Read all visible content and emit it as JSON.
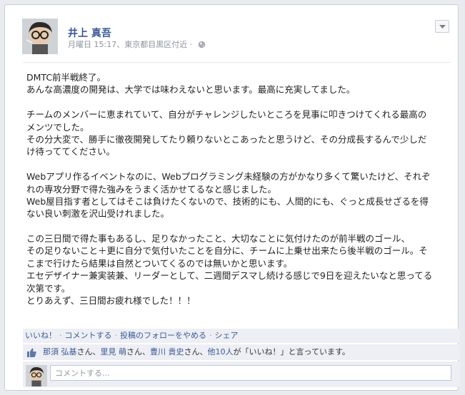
{
  "post": {
    "author": "井上 真吾",
    "meta": "月曜日 15:17、東京都目黒区付近 ·",
    "body_lines": [
      "DMTC前半戦終了。",
      "あんな高濃度の開発は、大学では味わえないと思います。最高に充実してました。",
      "",
      "チームのメンバーに恵まれていて、自分がチャレンジしたいところを見事に叩きつけてくれる最高の",
      "メンツでした。",
      "その分大変で、勝手に徹夜開発してたり頼りないとこあったと思うけど、その分成長するんで少しだ",
      "け待っててください。",
      "",
      "Webアプリ作るイベントなのに、Webプログラミング未経験の方がかなり多くて驚いたけど、それぞ",
      "れの専攻分野で得た強みをうまく活かせてるなと感じました。",
      "Web屋目指す者としてはそこは負けたくないので、技術的にも、人間的にも、ぐっと成長せざるを得",
      "ない良い刺激を沢山受けれました。",
      "",
      "この三日間で得た事もあるし、足りなかったこと、大切なことに気付けたのが前半戦のゴール、",
      "その足りないこと＋更に自分で気付いたことを自分に、チームに上乗せ出来たら後半戦のゴール。そ",
      "こまで行けたら結果は自然とついてくるのでは無いかと思います。",
      "エセデザイナー兼実装兼、リーダーとして、二週間デスマし続ける感じで9日を迎えたいなと思ってる",
      "次第です。",
      "とりあえず、三日間お疲れ様でした！！！"
    ]
  },
  "actions": {
    "like": "いいね！",
    "comment": "コメントする",
    "unfollow": "投稿のフォローをやめる",
    "share": "シェア",
    "separator": "·"
  },
  "likes": {
    "names": [
      "那須 弘基",
      "里見 萌",
      "豊川 貴史"
    ],
    "suffix_san": "さん",
    "comma": "、",
    "others_link": "他10人",
    "tail": "が「いいね！」と言っています。"
  },
  "comment": {
    "placeholder": "コメントする..."
  },
  "icons": {
    "globe": "globe-icon",
    "menu": "chevron-down-icon",
    "thumb": "thumbs-up-icon"
  },
  "colors": {
    "link": "#3b5998",
    "bar_bg": "#edeff4",
    "meta": "#8f94a0"
  }
}
